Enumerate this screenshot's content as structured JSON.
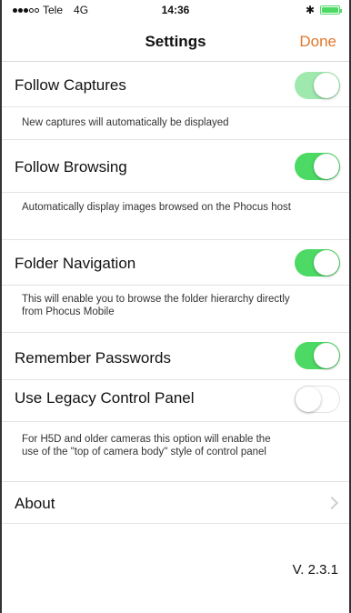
{
  "status_bar": {
    "carrier": "Tele",
    "network": "4G",
    "time": "14:36",
    "bluetooth_icon": "bluetooth-icon",
    "battery_icon": "battery-icon"
  },
  "nav": {
    "title": "Settings",
    "done_label": "Done",
    "accent_color": "#e0772c"
  },
  "settings": {
    "follow_captures": {
      "label": "Follow Captures",
      "enabled": true,
      "footer": "New captures will automatically be displayed"
    },
    "follow_browsing": {
      "label": "Follow Browsing",
      "enabled": true,
      "footer": "Automatically display images browsed on the Phocus host"
    },
    "folder_navigation": {
      "label": "Folder Navigation",
      "enabled": true,
      "footer": "This will enable you to browse the folder hierarchy directly from Phocus Mobile"
    },
    "remember_passwords": {
      "label": "Remember Passwords",
      "enabled": true
    },
    "legacy_control_panel": {
      "label": "Use Legacy Control Panel",
      "enabled": false,
      "footer": "For H5D and older cameras this option will enable the use of the \"top of camera body\" style of control panel"
    },
    "about": {
      "label": "About"
    }
  },
  "version": "V. 2.3.1",
  "toggle_on_color": "#4cd964"
}
